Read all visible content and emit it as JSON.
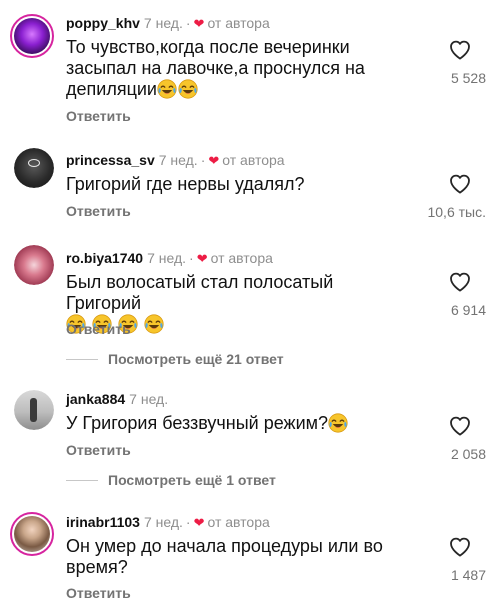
{
  "comments": [
    {
      "username": "poppy_khv",
      "time": "7 нед.",
      "author_label": "от автора",
      "text": "То чувство,когда после вечеринки засыпал на лавочке,а проснулся на депиляции",
      "emoji_count": 2,
      "reply_label": "Ответить",
      "likes": "5 528",
      "avatar_icon": "purple-neon-avatar"
    },
    {
      "username": "princessa_sv",
      "time": "7 нед.",
      "author_label": "от автора",
      "text": "Григорий где нервы удалял?",
      "emoji_count": 0,
      "reply_label": "Ответить",
      "likes": "10,6 тыс.",
      "avatar_icon": "dark-avatar"
    },
    {
      "username": "ro.biya1740",
      "time": "7 нед.",
      "author_label": "от автора",
      "text": "Был волосатый стал полосатый Григорий",
      "emoji_count": 4,
      "reply_label": "Ответить",
      "likes": "6 914",
      "avatar_icon": "flower-avatar"
    },
    {
      "username": "janka884",
      "time": "7 нед.",
      "author_label": "",
      "text": "У Григория беззвучный режим?",
      "emoji_count": 1,
      "reply_label": "Ответить",
      "likes": "2 058",
      "avatar_icon": "grey-photo-avatar"
    },
    {
      "username": "irinabr1103",
      "time": "7 нед.",
      "author_label": "от автора",
      "text": "Он умер до начала процедуры или во время?",
      "emoji_count": 0,
      "reply_label": "Ответить",
      "likes": "1 487",
      "avatar_icon": "woman-photo-avatar"
    }
  ],
  "view_more": [
    {
      "label": "Посмотреть ещё 21 ответ"
    },
    {
      "label": "Посмотреть ещё 1 ответ"
    }
  ],
  "colors": {
    "heart_red": "#ed1c45",
    "secondary_text": "#737373",
    "story_ring": "#d6249f"
  },
  "emoji_name": "face-with-tears-of-joy"
}
